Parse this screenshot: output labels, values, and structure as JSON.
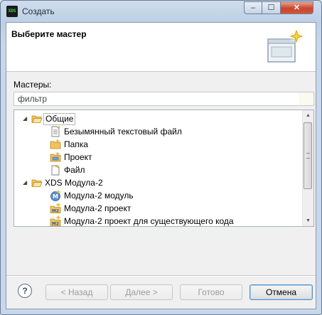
{
  "window": {
    "title": "Создать",
    "app_icon_text": "XDS",
    "minimize_glyph": "–",
    "maximize_glyph": "☐",
    "close_glyph": "✕"
  },
  "banner": {
    "title": "Выберите мастер"
  },
  "masters_label": "Мастеры:",
  "filter": {
    "value": "фильтр"
  },
  "tree": {
    "groups": [
      {
        "label": "Общие",
        "expanded": true,
        "selected": true,
        "items": [
          "Безымянный текстовый файл",
          "Папка",
          "Проект",
          "Файл"
        ]
      },
      {
        "label": "XDS Модула-2",
        "expanded": true,
        "selected": false,
        "items": [
          "Модула-2 модуль",
          "Модула-2 проект",
          "Модула-2 проект для существующего кода"
        ]
      }
    ]
  },
  "buttons": {
    "help": "?",
    "back": "< Назад",
    "next": "Далее >",
    "finish": "Готово",
    "cancel": "Отмена"
  },
  "colors": {
    "accent": "#5b8ec4",
    "folder": "#f2c25a",
    "close": "#c9452c"
  }
}
